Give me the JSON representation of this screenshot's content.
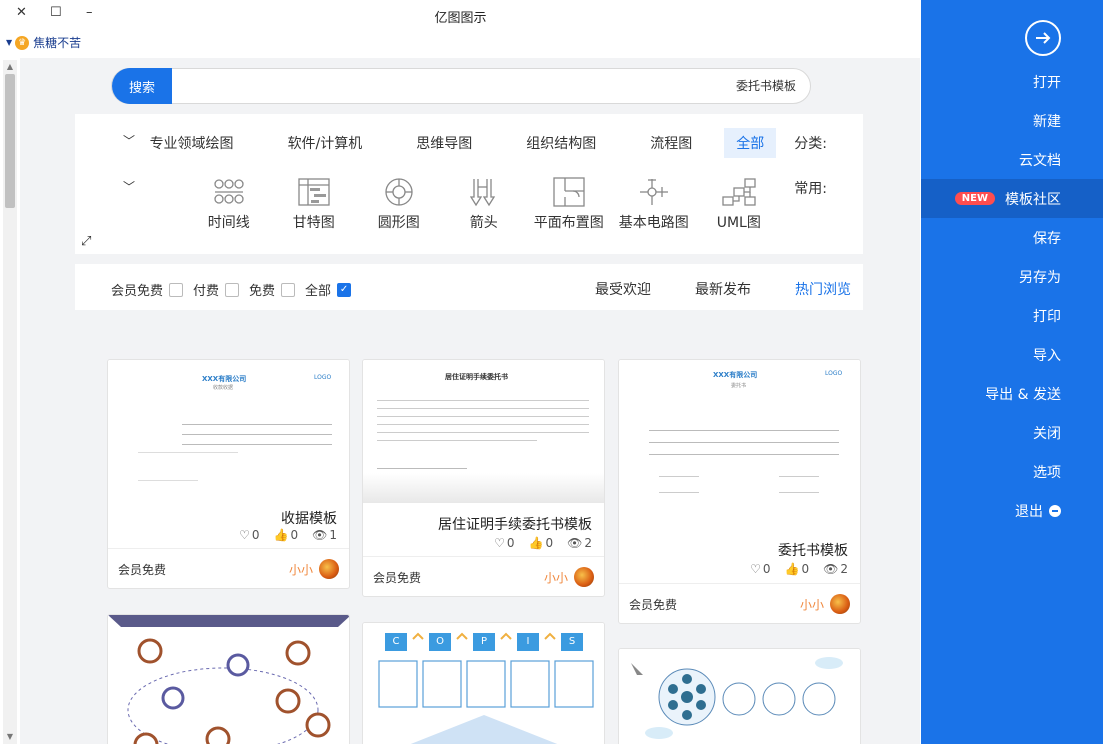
{
  "window": {
    "title": "亿图图示",
    "close_symbol": "✕",
    "maximize_symbol": "☐",
    "minimize_symbol": "–"
  },
  "user": {
    "name": "焦糖不苦",
    "vip_icon": "crown-icon"
  },
  "search": {
    "button_label": "搜索",
    "value": "委托书模板"
  },
  "categories": {
    "label": "分类:",
    "items": [
      "全部",
      "流程图",
      "组织结构图",
      "思维导图",
      "软件/计算机",
      "专业领域绘图"
    ],
    "selected": "全部"
  },
  "common": {
    "label": "常用:",
    "items": [
      {
        "label": "UML图",
        "icon": "uml-diagram-icon"
      },
      {
        "label": "基本电路图",
        "icon": "circuit-icon"
      },
      {
        "label": "平面布置图",
        "icon": "floorplan-icon"
      },
      {
        "label": "箭头",
        "icon": "arrow-shapes-icon"
      },
      {
        "label": "圆形图",
        "icon": "circular-diagram-icon"
      },
      {
        "label": "甘特图",
        "icon": "gantt-icon"
      },
      {
        "label": "时间线",
        "icon": "timeline-icon"
      }
    ]
  },
  "sort": {
    "options": [
      "热门浏览",
      "最新发布",
      "最受欢迎"
    ],
    "active": "热门浏览"
  },
  "filters": [
    {
      "label": "全部",
      "checked": true
    },
    {
      "label": "免费",
      "checked": false
    },
    {
      "label": "付费",
      "checked": false
    },
    {
      "label": "会员免费",
      "checked": false
    }
  ],
  "cards": [
    {
      "title": "委托书模板",
      "views": "2",
      "likes": "0",
      "favorites": "0",
      "price": "会员免费",
      "author": "小小",
      "doc_header": "XXX有限公司",
      "doc_logo": "LOGO",
      "doc_subtitle": "委托书"
    },
    {
      "title": "居住证明手续委托书模板",
      "views": "2",
      "likes": "0",
      "favorites": "0",
      "price": "会员免费",
      "author": "小小",
      "doc_header": "居住证明手续委托书"
    },
    {
      "title": "收据模板",
      "views": "1",
      "likes": "0",
      "favorites": "0",
      "price": "会员免费",
      "author": "小小",
      "doc_header": "XXX有限公司",
      "doc_logo": "LOGO",
      "doc_subtitle": "收款收据"
    }
  ],
  "card_row2": [
    {
      "labels": [
        "S",
        "I",
        "P",
        "O",
        "C"
      ]
    }
  ],
  "sidebar": {
    "items": [
      {
        "label": "打开"
      },
      {
        "label": "新建"
      },
      {
        "label": "云文档"
      },
      {
        "label": "模板社区",
        "badge": "NEW",
        "active": true
      },
      {
        "label": "保存"
      },
      {
        "label": "另存为"
      },
      {
        "label": "打印"
      },
      {
        "label": "导入"
      },
      {
        "label": "导出 & 发送"
      },
      {
        "label": "关闭"
      },
      {
        "label": "选项"
      },
      {
        "label": "退出"
      }
    ]
  }
}
